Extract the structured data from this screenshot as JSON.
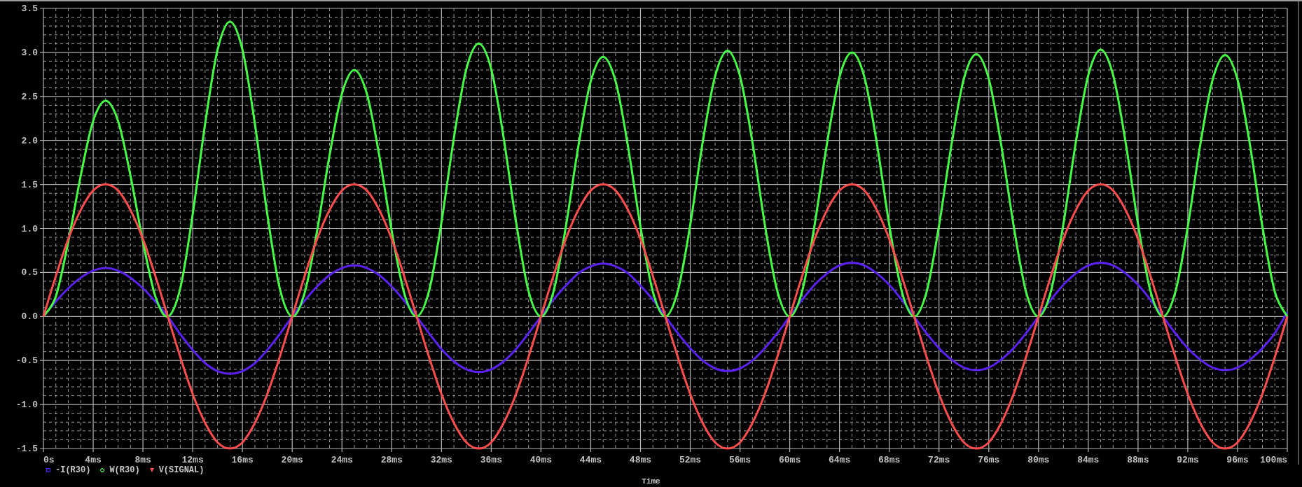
{
  "legend": [
    {
      "kind": "square"
    },
    {
      "kind": "diamond"
    },
    {
      "kind": "triangle"
    }
  ],
  "chart_data": {
    "type": "line",
    "xlabel": "Time",
    "grid": true,
    "x": [
      0,
      1,
      2,
      3,
      4,
      5,
      6,
      7,
      8,
      9,
      10,
      11,
      12,
      13,
      14,
      15,
      16,
      17,
      18,
      19,
      20,
      21,
      22,
      23,
      24,
      25,
      26,
      27,
      28,
      29,
      30,
      31,
      32,
      33,
      34,
      35,
      36,
      37,
      38,
      39,
      40,
      41,
      42,
      43,
      44,
      45,
      46,
      47,
      48,
      49,
      50,
      51,
      52,
      53,
      54,
      55,
      56,
      57,
      58,
      59,
      60,
      61,
      62,
      63,
      64,
      65,
      66,
      67,
      68,
      69,
      70,
      71,
      72,
      73,
      74,
      75,
      76,
      77,
      78,
      79,
      80,
      81,
      82,
      83,
      84,
      85,
      86,
      87,
      88,
      89,
      90,
      91,
      92,
      93,
      94,
      95,
      96,
      97,
      98,
      99,
      100
    ],
    "xlim": [
      0,
      100
    ],
    "ylim": [
      -1.5,
      3.5
    ],
    "xticks": [
      {
        "value": 0,
        "label": "0s"
      },
      {
        "value": 4,
        "label": "4ms"
      },
      {
        "value": 8,
        "label": "8ms"
      },
      {
        "value": 12,
        "label": "12ms"
      },
      {
        "value": 16,
        "label": "16ms"
      },
      {
        "value": 20,
        "label": "20ms"
      },
      {
        "value": 24,
        "label": "24ms"
      },
      {
        "value": 28,
        "label": "28ms"
      },
      {
        "value": 32,
        "label": "32ms"
      },
      {
        "value": 36,
        "label": "36ms"
      },
      {
        "value": 40,
        "label": "40ms"
      },
      {
        "value": 44,
        "label": "44ms"
      },
      {
        "value": 48,
        "label": "48ms"
      },
      {
        "value": 52,
        "label": "52ms"
      },
      {
        "value": 56,
        "label": "56ms"
      },
      {
        "value": 60,
        "label": "60ms"
      },
      {
        "value": 64,
        "label": "64ms"
      },
      {
        "value": 68,
        "label": "68ms"
      },
      {
        "value": 72,
        "label": "72ms"
      },
      {
        "value": 76,
        "label": "76ms"
      },
      {
        "value": 80,
        "label": "80ms"
      },
      {
        "value": 84,
        "label": "84ms"
      },
      {
        "value": 88,
        "label": "88ms"
      },
      {
        "value": 92,
        "label": "92ms"
      },
      {
        "value": 96,
        "label": "96ms"
      },
      {
        "value": 100,
        "label": "100ms"
      }
    ],
    "yticks": [
      {
        "value": 3.5,
        "label": "3.5"
      },
      {
        "value": 3,
        "label": "3.0"
      },
      {
        "value": 2.5,
        "label": "2.5"
      },
      {
        "value": 2,
        "label": "2.0"
      },
      {
        "value": 1.5,
        "label": "1.5"
      },
      {
        "value": 1,
        "label": "1.0"
      },
      {
        "value": 0.5,
        "label": "0.5"
      },
      {
        "value": 0,
        "label": "0.0"
      },
      {
        "value": -0.5,
        "label": "-0.5"
      },
      {
        "value": -1,
        "label": "-1.0"
      },
      {
        "value": -1.5,
        "label": "-1.5"
      }
    ],
    "series": [
      {
        "name": "-I(R30)",
        "color": "#5b21f0",
        "values": [
          0,
          0.17,
          0.32,
          0.44,
          0.52,
          0.55,
          0.52,
          0.44,
          0.32,
          0.17,
          0,
          -0.2,
          -0.38,
          -0.53,
          -0.62,
          -0.65,
          -0.62,
          -0.53,
          -0.38,
          -0.2,
          0,
          0.18,
          0.34,
          0.47,
          0.55,
          0.58,
          0.55,
          0.47,
          0.34,
          0.18,
          0,
          -0.19,
          -0.37,
          -0.51,
          -0.6,
          -0.63,
          -0.6,
          -0.51,
          -0.37,
          -0.19,
          0,
          0.19,
          0.35,
          0.49,
          0.57,
          0.6,
          0.57,
          0.49,
          0.35,
          0.19,
          0,
          -0.19,
          -0.36,
          -0.5,
          -0.59,
          -0.62,
          -0.59,
          -0.5,
          -0.36,
          -0.19,
          0,
          0.19,
          0.36,
          0.49,
          0.58,
          0.61,
          0.58,
          0.49,
          0.36,
          0.19,
          0,
          -0.19,
          -0.36,
          -0.49,
          -0.58,
          -0.61,
          -0.58,
          -0.49,
          -0.36,
          -0.19,
          0,
          0.19,
          0.36,
          0.49,
          0.58,
          0.61,
          0.58,
          0.49,
          0.36,
          0.19,
          0,
          -0.19,
          -0.36,
          -0.49,
          -0.58,
          -0.61,
          -0.58,
          -0.49,
          -0.36,
          -0.19,
          0.05
        ]
      },
      {
        "name": "W(R30)",
        "color": "#44ff44",
        "values": [
          0,
          0.23,
          0.85,
          1.6,
          2.22,
          2.45,
          2.22,
          1.6,
          0.85,
          0.23,
          0,
          0.32,
          1.16,
          2.19,
          3.03,
          3.35,
          3.03,
          2.19,
          1.16,
          0.32,
          0,
          0.27,
          0.97,
          1.83,
          2.53,
          2.8,
          2.53,
          1.83,
          0.97,
          0.27,
          0,
          0.29,
          1.07,
          2.03,
          2.81,
          3.1,
          2.81,
          2.03,
          1.07,
          0.29,
          0,
          0.28,
          1.02,
          1.93,
          2.67,
          2.95,
          2.67,
          1.93,
          1.02,
          0.28,
          0,
          0.29,
          1.04,
          1.98,
          2.73,
          3.02,
          2.73,
          1.98,
          1.04,
          0.29,
          0,
          0.29,
          1.04,
          1.97,
          2.72,
          3.0,
          2.72,
          1.97,
          1.04,
          0.29,
          0,
          0.28,
          1.03,
          1.95,
          2.7,
          2.98,
          2.7,
          1.95,
          1.03,
          0.28,
          0,
          0.29,
          1.05,
          1.98,
          2.74,
          3.03,
          2.74,
          1.98,
          1.05,
          0.29,
          0,
          0.28,
          1.02,
          1.95,
          2.69,
          2.97,
          2.69,
          1.95,
          1.02,
          0.28,
          0
        ]
      },
      {
        "name": "V(SIGNAL)",
        "color": "#ff4d4d",
        "values": [
          0,
          0.46,
          0.88,
          1.21,
          1.43,
          1.5,
          1.43,
          1.21,
          0.88,
          0.46,
          0,
          -0.46,
          -0.88,
          -1.21,
          -1.43,
          -1.5,
          -1.43,
          -1.21,
          -0.88,
          -0.46,
          0,
          0.46,
          0.88,
          1.21,
          1.43,
          1.5,
          1.43,
          1.21,
          0.88,
          0.46,
          0,
          -0.46,
          -0.88,
          -1.21,
          -1.43,
          -1.5,
          -1.43,
          -1.21,
          -0.88,
          -0.46,
          0,
          0.46,
          0.88,
          1.21,
          1.43,
          1.5,
          1.43,
          1.21,
          0.88,
          0.46,
          0,
          -0.46,
          -0.88,
          -1.21,
          -1.43,
          -1.5,
          -1.43,
          -1.21,
          -0.88,
          -0.46,
          0,
          0.46,
          0.88,
          1.21,
          1.43,
          1.5,
          1.43,
          1.21,
          0.88,
          0.46,
          0,
          -0.46,
          -0.88,
          -1.21,
          -1.43,
          -1.5,
          -1.43,
          -1.21,
          -0.88,
          -0.46,
          0,
          0.46,
          0.88,
          1.21,
          1.43,
          1.5,
          1.43,
          1.21,
          0.88,
          0.46,
          0,
          -0.46,
          -0.88,
          -1.21,
          -1.43,
          -1.5,
          -1.43,
          -1.21,
          -0.88,
          -0.46,
          0
        ]
      }
    ]
  }
}
